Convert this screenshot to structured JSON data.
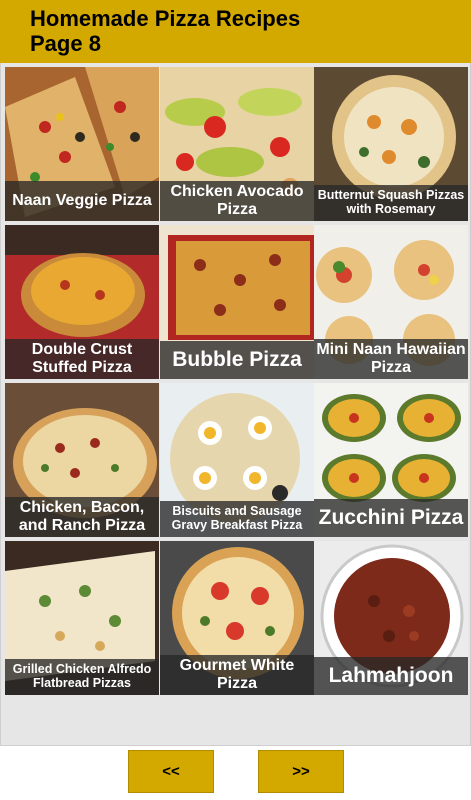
{
  "header": {
    "title_line1": "Homemade Pizza Recipes",
    "title_line2": "Page 8"
  },
  "recipes": [
    {
      "label": "Naan Veggie Pizza"
    },
    {
      "label": "Chicken Avocado Pizza"
    },
    {
      "label": "Butternut Squash Pizzas with Rosemary"
    },
    {
      "label": "Double Crust Stuffed Pizza"
    },
    {
      "label": "Bubble Pizza"
    },
    {
      "label": "Mini Naan Hawaiian Pizza"
    },
    {
      "label": "Chicken, Bacon, and Ranch Pizza"
    },
    {
      "label": "Biscuits and Sausage Gravy Breakfast Pizza"
    },
    {
      "label": "Zucchini Pizza"
    },
    {
      "label": "Grilled Chicken Alfredo Flatbread Pizzas"
    },
    {
      "label": "Gourmet White Pizza"
    },
    {
      "label": "Lahmahjoon"
    }
  ],
  "nav": {
    "prev_label": "<<",
    "next_label": ">>"
  },
  "colors": {
    "header_bg": "#d3a900",
    "button_bg": "#d3a900",
    "caption_bg": "#282828"
  }
}
